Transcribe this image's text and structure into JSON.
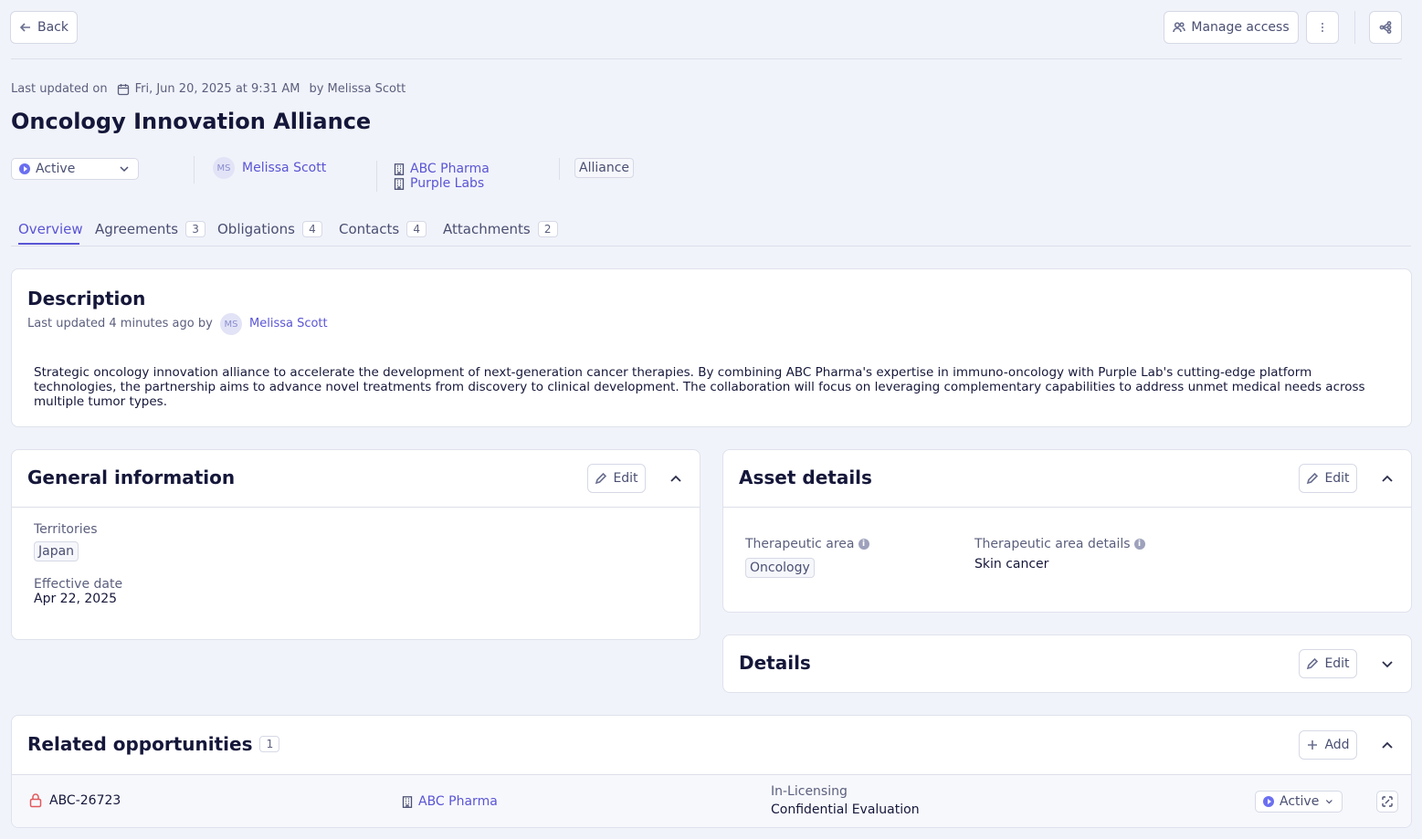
{
  "header": {
    "back_label": "Back",
    "manage_access_label": "Manage access"
  },
  "meta": {
    "prefix": "Last updated on",
    "date": "Fri, Jun 20, 2025 at 9:31 AM",
    "by": "by Melissa Scott"
  },
  "page_title": "Oncology Innovation Alliance",
  "summary": {
    "status": "Active",
    "owner_initials": "MS",
    "owner_name": "Melissa Scott",
    "companies": [
      "ABC Pharma",
      "Purple Labs"
    ],
    "type_tag": "Alliance"
  },
  "tabs": [
    {
      "label": "Overview",
      "count": ""
    },
    {
      "label": "Agreements",
      "count": "3"
    },
    {
      "label": "Obligations",
      "count": "4"
    },
    {
      "label": "Contacts",
      "count": "4"
    },
    {
      "label": "Attachments",
      "count": "2"
    }
  ],
  "description": {
    "title": "Description",
    "updated_prefix": "Last updated 4 minutes ago by",
    "updated_initials": "MS",
    "updated_name": "Melissa Scott",
    "body": "Strategic oncology innovation alliance to accelerate the development of next-generation cancer therapies. By combining ABC Pharma's expertise in immuno-oncology with Purple Lab's cutting-edge platform technologies, the partnership aims to advance novel treatments from discovery to clinical development. The collaboration will focus on leveraging complementary capabilities to address unmet medical needs across multiple tumor types."
  },
  "general": {
    "title": "General information",
    "edit_label": "Edit",
    "territories_label": "Territories",
    "territory": "Japan",
    "effective_label": "Effective date",
    "effective_value": "Apr 22, 2025"
  },
  "asset": {
    "title": "Asset details",
    "edit_label": "Edit",
    "therapeutic_label": "Therapeutic area",
    "therapeutic_value": "Oncology",
    "therapeutic_details_label": "Therapeutic area details",
    "therapeutic_details_value": "Skin cancer"
  },
  "details": {
    "title": "Details",
    "edit_label": "Edit"
  },
  "related": {
    "title": "Related opportunities",
    "count": "1",
    "add_label": "Add",
    "row": {
      "id": "ABC-26723",
      "company": "ABC Pharma",
      "type": "In-Licensing",
      "subtitle": "Confidential Evaluation",
      "status": "Active"
    }
  },
  "colors": {
    "accent": "#5a55d4",
    "status_dot": "#6b6ff0",
    "lock": "#e0585b",
    "background": "#f1f3fa"
  }
}
